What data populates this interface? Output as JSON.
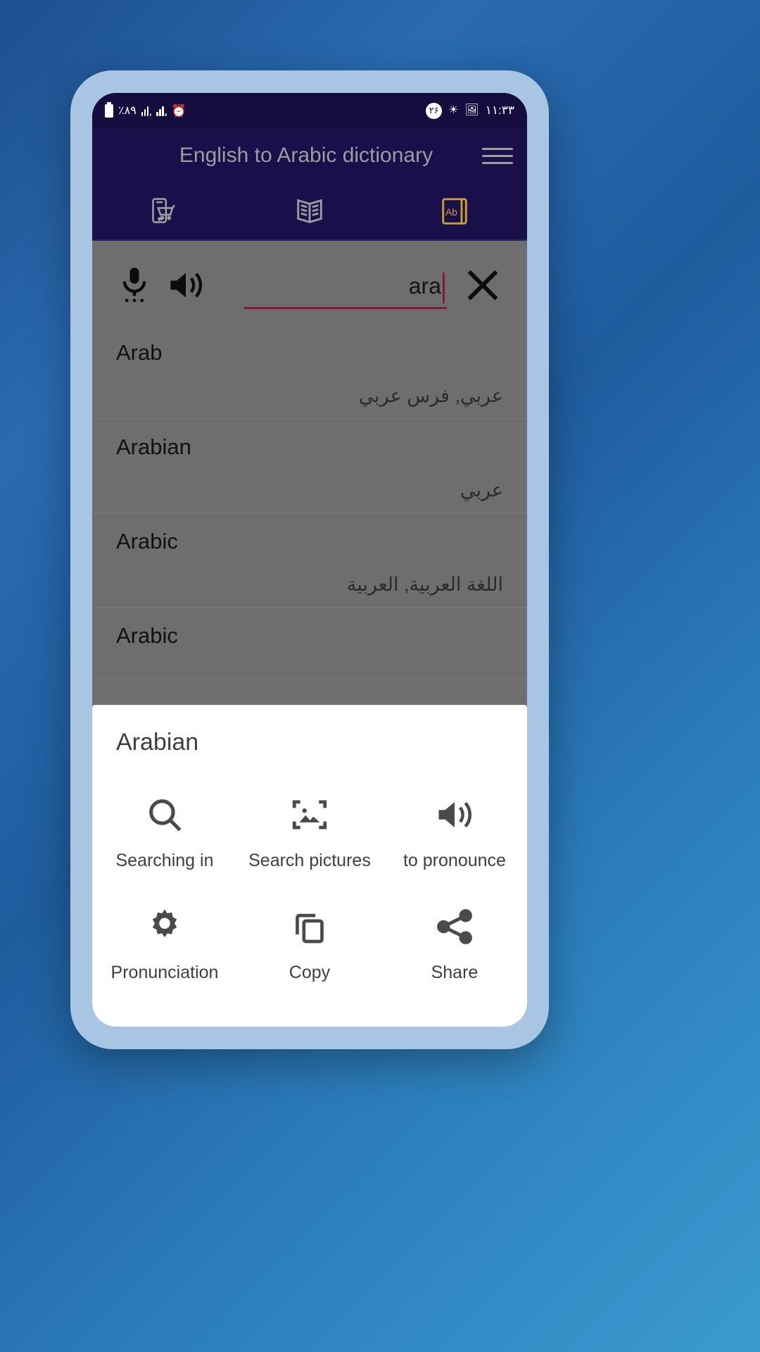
{
  "status_bar": {
    "battery_percent": "٪٨٩",
    "alarm_icon": "⏰",
    "notification_count": "٢۶",
    "brightness_icon": "☀",
    "gallery_icon": "🖼",
    "clock": "١١:٣٣"
  },
  "app_bar": {
    "title": "English to Arabic dictionary",
    "menu_label": "menu"
  },
  "tabs": [
    {
      "name": "mobile-cart",
      "label": ""
    },
    {
      "name": "open-book",
      "label": ""
    },
    {
      "name": "ab-dictionary",
      "label": "Ab"
    }
  ],
  "search": {
    "value": "ara",
    "placeholder": "",
    "mic_label": "voice input",
    "speaker_label": "pronounce",
    "clear_label": "clear"
  },
  "results": [
    {
      "english": "Arab",
      "arabic": "عربي, فرس عربي"
    },
    {
      "english": "Arabian",
      "arabic": "عربي"
    },
    {
      "english": "Arabic",
      "arabic": "اللغة العربية, العربية"
    },
    {
      "english": "Arabic",
      "arabic": ""
    }
  ],
  "bottom_sheet": {
    "title": "Arabian",
    "actions": [
      {
        "icon": "search-icon",
        "label": "Searching in"
      },
      {
        "icon": "image-search-icon",
        "label": "Search pictures"
      },
      {
        "icon": "speaker-icon",
        "label": "to pronounce"
      },
      {
        "icon": "gear-icon",
        "label": "Pronunciation"
      },
      {
        "icon": "copy-icon",
        "label": "Copy"
      },
      {
        "icon": "share-icon",
        "label": "Share"
      }
    ]
  },
  "colors": {
    "header": "#190f4b",
    "status_bar": "#140d3e",
    "accent": "#8a1538",
    "tab_active": "#c9a227",
    "dim_overlay": "#6e6e6e"
  }
}
